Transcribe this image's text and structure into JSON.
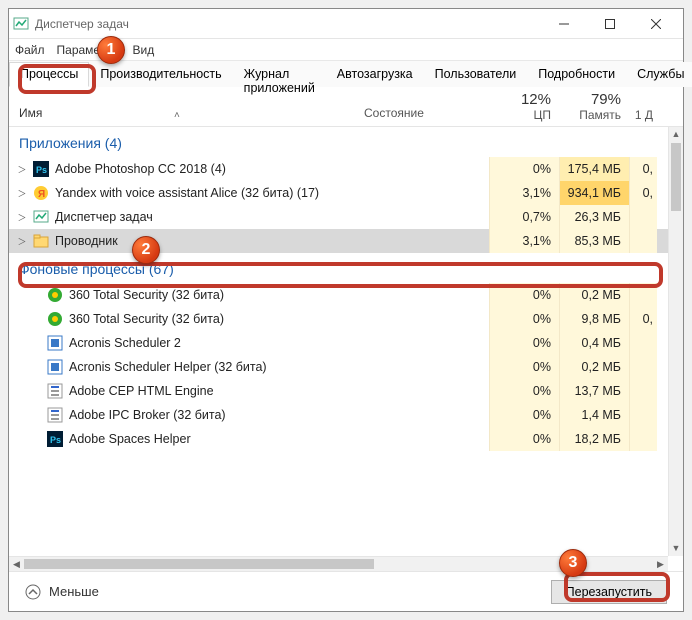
{
  "window": {
    "title": "Диспетчер задач"
  },
  "menu": {
    "file": "Файл",
    "params": "Параметры",
    "view": "Вид"
  },
  "tabs": {
    "processes": "Процессы",
    "performance": "Производительность",
    "app_history": "Журнал приложений",
    "startup": "Автозагрузка",
    "users": "Пользователи",
    "details": "Подробности",
    "services": "Службы"
  },
  "columns": {
    "name": "Имя",
    "state": "Состояние",
    "cpu_pct": "12%",
    "cpu_label": "ЦП",
    "mem_pct": "79%",
    "mem_label": "Память",
    "extra_pct": "1",
    "extra_label": "Д"
  },
  "groups": {
    "apps": {
      "label": "Приложения (4)"
    },
    "background": {
      "label": "Фоновые процессы (67)"
    }
  },
  "rows": {
    "apps": [
      {
        "name": "Adobe Photoshop CC 2018 (4)",
        "cpu": "0%",
        "mem": "175,4 МБ",
        "extra": "0,",
        "icon": "ps",
        "expandable": true,
        "cpu_heat": 0,
        "mem_heat": 1
      },
      {
        "name": "Yandex with voice assistant Alice (32 бита) (17)",
        "cpu": "3,1%",
        "mem": "934,1 МБ",
        "extra": "0,",
        "icon": "ya",
        "expandable": true,
        "cpu_heat": 0,
        "mem_heat": 2
      },
      {
        "name": "Диспетчер задач",
        "cpu": "0,7%",
        "mem": "26,3 МБ",
        "extra": "",
        "icon": "tm",
        "expandable": true,
        "cpu_heat": 0,
        "mem_heat": 0
      },
      {
        "name": "Проводник",
        "cpu": "3,1%",
        "mem": "85,3 МБ",
        "extra": "",
        "icon": "ex",
        "expandable": true,
        "selected": true,
        "cpu_heat": 0,
        "mem_heat": 0
      }
    ],
    "background": [
      {
        "name": "360 Total Security (32 бита)",
        "cpu": "0%",
        "mem": "0,2 МБ",
        "extra": "",
        "icon": "360",
        "cpu_heat": 0,
        "mem_heat": 0
      },
      {
        "name": "360 Total Security (32 бита)",
        "cpu": "0%",
        "mem": "9,8 МБ",
        "extra": "0,",
        "icon": "360",
        "cpu_heat": 0,
        "mem_heat": 0
      },
      {
        "name": "Acronis Scheduler 2",
        "cpu": "0%",
        "mem": "0,4 МБ",
        "extra": "",
        "icon": "acr",
        "cpu_heat": 0,
        "mem_heat": 0
      },
      {
        "name": "Acronis Scheduler Helper (32 бита)",
        "cpu": "0%",
        "mem": "0,2 МБ",
        "extra": "",
        "icon": "acr",
        "cpu_heat": 0,
        "mem_heat": 0
      },
      {
        "name": "Adobe CEP HTML Engine",
        "cpu": "0%",
        "mem": "13,7 МБ",
        "extra": "",
        "icon": "gen",
        "cpu_heat": 0,
        "mem_heat": 0
      },
      {
        "name": "Adobe IPC Broker (32 бита)",
        "cpu": "0%",
        "mem": "1,4 МБ",
        "extra": "",
        "icon": "gen",
        "cpu_heat": 0,
        "mem_heat": 0
      },
      {
        "name": "Adobe Spaces Helper",
        "cpu": "0%",
        "mem": "18,2 МБ",
        "extra": "",
        "icon": "ps",
        "cpu_heat": 0,
        "mem_heat": 0
      }
    ]
  },
  "footer": {
    "fewer": "Меньше",
    "restart": "Перезапустить"
  },
  "annotations": {
    "b1": "1",
    "b2": "2",
    "b3": "3"
  }
}
